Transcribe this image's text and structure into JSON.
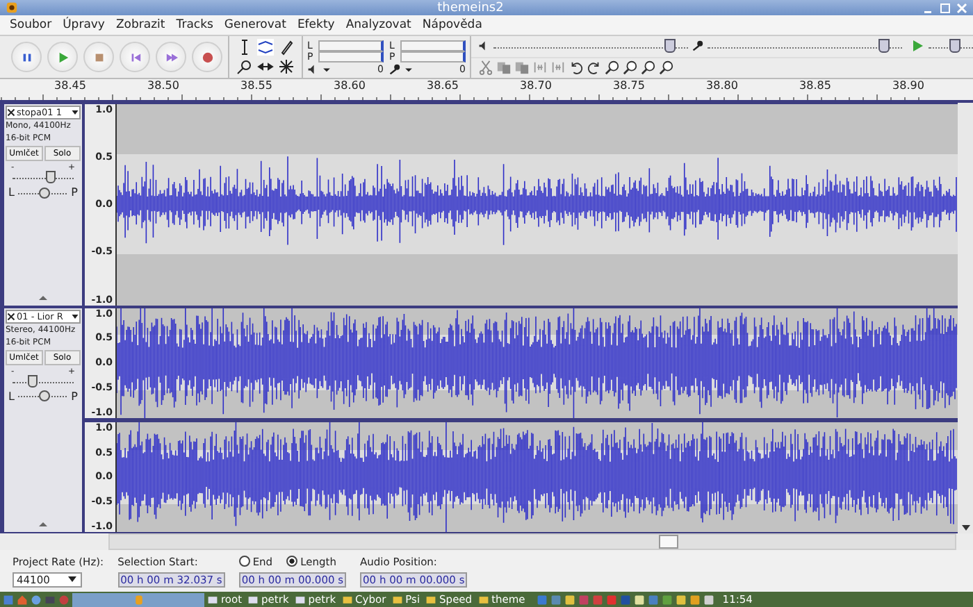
{
  "window": {
    "title": "themeins2"
  },
  "menu": [
    {
      "label": "Soubor"
    },
    {
      "label": "Úpravy"
    },
    {
      "label": "Zobrazit"
    },
    {
      "label": "Tracks"
    },
    {
      "label": "Generovat"
    },
    {
      "label": "Efekty"
    },
    {
      "label": "Analyzovat"
    },
    {
      "label": "Nápověda"
    }
  ],
  "meters": [
    {
      "left": "L",
      "right": "P",
      "scale_end": "0"
    },
    {
      "left": "L",
      "right": "P",
      "scale_end": "0"
    }
  ],
  "mixer": {
    "playback": {
      "level": 0.9
    },
    "record": {
      "level": 0.9
    },
    "speed": {
      "level": 0.25
    }
  },
  "ruler": {
    "ticks": [
      "38.45",
      "38.50",
      "38.55",
      "38.60",
      "38.65",
      "38.70",
      "38.75",
      "38.80",
      "38.85",
      "38.90"
    ]
  },
  "tracks": [
    {
      "name": "stopa01 1",
      "format": "Mono, 44100Hz",
      "bits": "16-bit PCM",
      "mute": "Umlčet",
      "solo": "Solo",
      "gain_minus": "-",
      "gain_plus": "+",
      "gain": {
        "level": 0.6
      },
      "pan_left": "L",
      "pan_right": "P",
      "pan": {
        "level": 0.5
      },
      "channels": [
        {
          "kind": "quiet",
          "scale": [
            "1.0",
            "0.5",
            "0.0",
            "-0.5",
            "-1.0"
          ]
        }
      ]
    },
    {
      "name": "01 - Lior R",
      "format": "Stereo, 44100Hz",
      "bits": "16-bit PCM",
      "mute": "Umlčet",
      "solo": "Solo",
      "gain_minus": "-",
      "gain_plus": "+",
      "gain": {
        "level": 0.3
      },
      "pan_left": "L",
      "pan_right": "P",
      "pan": {
        "level": 0.5
      },
      "channels": [
        {
          "kind": "loud",
          "scale": [
            "1.0",
            "0.5",
            "0.0",
            "-0.5",
            "-1.0"
          ]
        },
        {
          "kind": "loud",
          "scale": [
            "1.0",
            "0.5",
            "0.0",
            "-0.5",
            "-1.0"
          ]
        }
      ]
    }
  ],
  "selection": {
    "rate_label": "Project Rate (Hz):",
    "rate": "44100",
    "start_label": "Selection Start:",
    "start": "00 h 00 m 32.037 s",
    "end_label": "End",
    "end_selected": false,
    "length_label": "Length",
    "length_selected": true,
    "end_value": "00 h 00 m 00.000 s",
    "position_label": "Audio Position:",
    "position": "00 h 00 m 00.000 s"
  },
  "taskbar": {
    "items": [
      {
        "label": "root"
      },
      {
        "label": "petrk"
      },
      {
        "label": "petrk"
      },
      {
        "label": "Cybor"
      },
      {
        "label": "Psi"
      },
      {
        "label": "Speed"
      },
      {
        "label": "theme"
      }
    ],
    "clock": "11:54"
  }
}
